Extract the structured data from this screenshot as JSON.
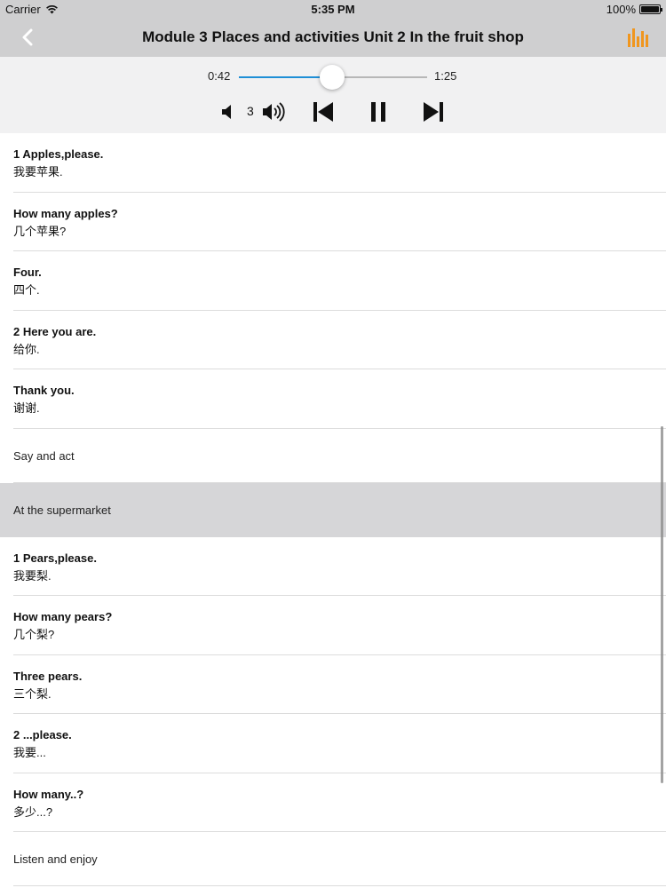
{
  "status_bar": {
    "carrier": "Carrier",
    "time": "5:35 PM",
    "battery": "100%",
    "battery_level": 1.0
  },
  "nav": {
    "title": "Module 3 Places and activities Unit 2 In the fruit shop",
    "back_icon": "chevron-left-icon",
    "right_icon": "bar-chart-icon",
    "accent_color": "#f0961e"
  },
  "player": {
    "current_time": "0:42",
    "total_time": "1:25",
    "progress": 0.494,
    "volume_level": "3",
    "progress_color": "#1e8fd6"
  },
  "list": {
    "items": [
      {
        "type": "sentence",
        "en": "1 Apples,please.",
        "zh": "我要苹果."
      },
      {
        "type": "sentence",
        "en": "How many apples?",
        "zh": "几个苹果?"
      },
      {
        "type": "sentence",
        "en": "Four.",
        "zh": "四个."
      },
      {
        "type": "sentence",
        "en": "2 Here you are.",
        "zh": "给你."
      },
      {
        "type": "sentence",
        "en": "Thank you.",
        "zh": "谢谢."
      },
      {
        "type": "section",
        "label": "Say and act"
      },
      {
        "type": "section",
        "label": "At the supermarket",
        "highlighted": true
      },
      {
        "type": "sentence",
        "en": "1 Pears,please.",
        "zh": "我要梨."
      },
      {
        "type": "sentence",
        "en": "How many pears?",
        "zh": "几个梨?"
      },
      {
        "type": "sentence",
        "en": "Three pears.",
        "zh": "三个梨."
      },
      {
        "type": "sentence",
        "en": "2 ...please.",
        "zh": "我要..."
      },
      {
        "type": "sentence",
        "en": "How many..?",
        "zh": "多少...?"
      },
      {
        "type": "section",
        "label": "Listen and enjoy"
      }
    ]
  }
}
